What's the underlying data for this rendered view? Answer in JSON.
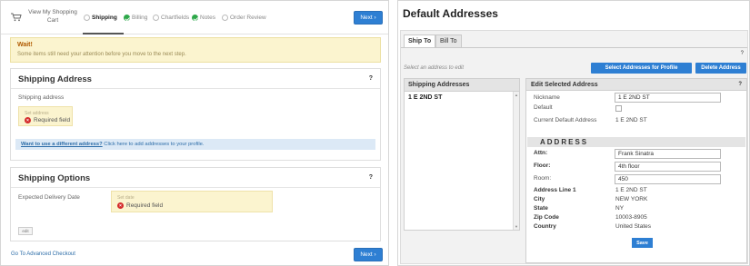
{
  "checkout": {
    "cart_label": "View My Shopping Cart",
    "steps": [
      {
        "label": "Shipping",
        "state": "active"
      },
      {
        "label": "Billing",
        "state": "done"
      },
      {
        "label": "Chartfields",
        "state": "pending"
      },
      {
        "label": "Notes",
        "state": "done"
      },
      {
        "label": "Order Review",
        "state": "pending"
      }
    ],
    "next_label": "Next",
    "warning": {
      "title": "Wait!",
      "text": "Some items still need your attention before you move to the next step."
    },
    "shipping_address": {
      "title": "Shipping Address",
      "help": "?",
      "field_label": "Shipping address",
      "req_caption": "Set address",
      "required_text": "Required field",
      "link_text": "Want to use a different address?",
      "link_rest": "Click here to add addresses to your profile."
    },
    "shipping_options": {
      "title": "Shipping Options",
      "help": "?",
      "field_label": "Expected Delivery Date",
      "req_caption": "Set date",
      "required_text": "Required field",
      "edit_label": "edit"
    },
    "advanced_link": "Go To Advanced Checkout"
  },
  "addresses": {
    "title": "Default Addresses",
    "tabs": [
      "Ship To",
      "Bill To"
    ],
    "help": "?",
    "select_hint": "Select an address to edit",
    "select_button": "Select Addresses for Profile",
    "delete_button": "Delete Address",
    "list_header": "Shipping Addresses",
    "list_items": [
      "1 E 2ND ST"
    ],
    "edit_header": "Edit Selected Address",
    "edit_help": "?",
    "fields": {
      "nickname_label": "Nickname",
      "nickname_value": "1 E 2ND ST",
      "default_label": "Default",
      "current_default_label": "Current Default Address",
      "current_default_value": "1 E 2ND ST",
      "section_label": "ADDRESS",
      "attn_label": "Attn:",
      "attn_value": "Frank Sinatra",
      "floor_label": "Floor:",
      "floor_value": "4th floor",
      "room_label": "Room:",
      "room_value": "450",
      "line1_label": "Address Line 1",
      "line1_value": "1 E 2ND ST",
      "city_label": "City",
      "city_value": "NEW YORK",
      "state_label": "State",
      "state_value": "NY",
      "zip_label": "Zip Code",
      "zip_value": "10003-8905",
      "country_label": "Country",
      "country_value": "United States"
    },
    "save_label": "Save"
  }
}
